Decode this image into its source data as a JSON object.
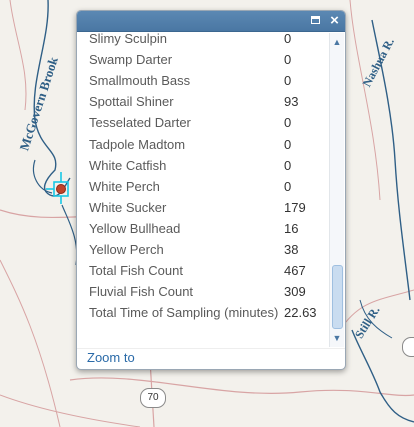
{
  "map": {
    "labels": {
      "mcgovern_brook": "McGovern Brook",
      "nashua_r": "Nashua R.",
      "still_r": "Still R."
    },
    "road_shield": "70",
    "colors": {
      "water": "#2f5f86",
      "roads": "#d8a4a4",
      "background": "#f3f1ec"
    }
  },
  "popup": {
    "rows": [
      {
        "name": "Slimy Sculpin",
        "value": "0"
      },
      {
        "name": "Swamp Darter",
        "value": "0"
      },
      {
        "name": "Smallmouth Bass",
        "value": "0"
      },
      {
        "name": "Spottail Shiner",
        "value": "93"
      },
      {
        "name": "Tesselated Darter",
        "value": "0"
      },
      {
        "name": "Tadpole Madtom",
        "value": "0"
      },
      {
        "name": "White Catfish",
        "value": "0"
      },
      {
        "name": "White Perch",
        "value": "0"
      },
      {
        "name": "White Sucker",
        "value": "179"
      },
      {
        "name": "Yellow Bullhead",
        "value": "16"
      },
      {
        "name": "Yellow Perch",
        "value": "38"
      },
      {
        "name": "Total Fish Count",
        "value": "467"
      },
      {
        "name": "Fluvial Fish Count",
        "value": "309"
      },
      {
        "name": "Total Time of Sampling (minutes)",
        "value": "22.63"
      }
    ],
    "zoom_link": "Zoom to",
    "icons": {
      "maximize": "maximize-icon",
      "close": "close-icon",
      "scroll_up": "chevron-up-icon",
      "scroll_down": "chevron-down-icon"
    }
  }
}
